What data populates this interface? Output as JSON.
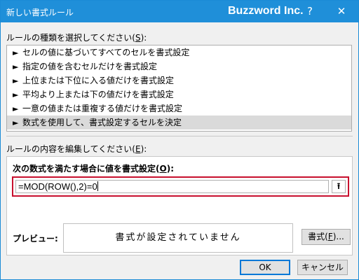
{
  "titlebar": {
    "title": "新しい書式ルール",
    "brand": "Buzzword Inc.",
    "help_glyph": "?",
    "close_glyph": "✕"
  },
  "rule_type": {
    "label_before": "ルールの種類を選択してください(",
    "label_key": "S",
    "label_after": "):",
    "items": [
      {
        "label": "セルの値に基づいてすべてのセルを書式設定",
        "selected": false
      },
      {
        "label": "指定の値を含むセルだけを書式設定",
        "selected": false
      },
      {
        "label": "上位または下位に入る値だけを書式設定",
        "selected": false
      },
      {
        "label": "平均より上または下の値だけを書式設定",
        "selected": false
      },
      {
        "label": "一意の値または重複する値だけを書式設定",
        "selected": false
      },
      {
        "label": "数式を使用して、書式設定するセルを決定",
        "selected": true
      }
    ],
    "arrow_glyph": "►"
  },
  "rule_edit": {
    "label_before": "ルールの内容を編集してください(",
    "label_key": "E",
    "label_after": "):",
    "formula_label_before": "次の数式を満たす場合に値を書式設定(",
    "formula_label_key": "O",
    "formula_label_after": "):",
    "formula_value": "=MOD(ROW(),2)=0",
    "ref_glyph": "⭱",
    "preview_label": "プレビュー:",
    "preview_text": "書式が設定されていません",
    "format_button_before": "書式(",
    "format_button_key": "F",
    "format_button_after": ")..."
  },
  "buttons": {
    "ok": "OK",
    "cancel": "キャンセル"
  },
  "colors": {
    "titlebar": "#1f8fd9",
    "highlight_border": "#c8102e",
    "selected_row": "#dadada"
  }
}
